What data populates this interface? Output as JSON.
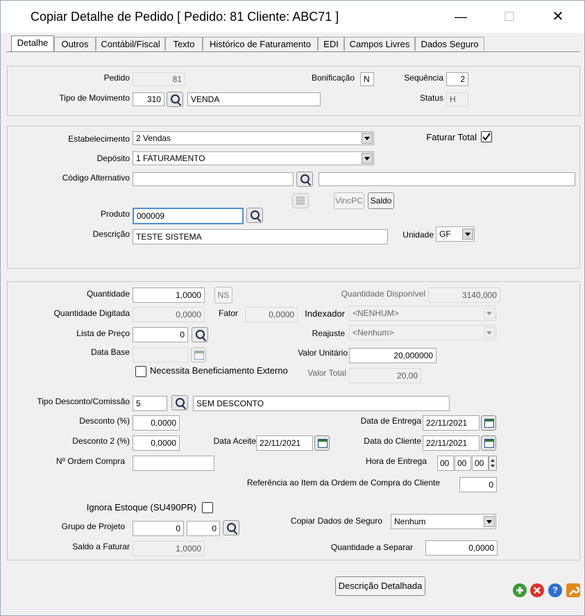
{
  "window": {
    "title": "Copiar Detalhe de Pedido [ Pedido: 81  Cliente: ABC71 ]"
  },
  "tabs": [
    "Detalhe",
    "Outros",
    "Contábil/Fiscal",
    "Texto",
    "Histórico de Faturamento",
    "EDI",
    "Campos Livres",
    "Dados Seguro"
  ],
  "header": {
    "pedido_label": "Pedido",
    "pedido_value": "81",
    "tipo_mov_label": "Tipo de Movimento",
    "tipo_mov_code": "310",
    "tipo_mov_desc": "VENDA",
    "bonificacao_label": "Bonificação",
    "bonificacao_value": "N",
    "sequencia_label": "Sequência",
    "sequencia_value": "2",
    "status_label": "Status",
    "status_value": "H"
  },
  "product": {
    "estab_label": "Estabelecimento",
    "estab_value": "2 Vendas",
    "deposito_label": "Depósito",
    "deposito_value": "1 FATURAMENTO",
    "cod_alt_label": "Código Alternativo",
    "cod_alt_value": "",
    "cod_alt_desc": "",
    "faturar_total_label": "Faturar Total",
    "vincpc_label": "VincPC",
    "saldo_label": "Saldo",
    "produto_label": "Produto",
    "produto_value": "000009",
    "descricao_label": "Descrição",
    "descricao_value": "TESTE SISTEMA",
    "unidade_label": "Unidade",
    "unidade_value": "GF"
  },
  "detail": {
    "quantidade_label": "Quantidade",
    "quantidade_value": "1,0000",
    "ns_label": "NS",
    "qtd_disp_label": "Quantidade Disponível",
    "qtd_disp_value": "3140,000",
    "qtd_dig_label": "Quantidade Digitada",
    "qtd_dig_value": "0,0000",
    "fator_label": "Fator",
    "fator_value": "0,0000",
    "indexador_label": "Indexador",
    "indexador_value": "<NENHUM>",
    "lista_label": "Lista de Preço",
    "lista_value": "0",
    "reajuste_label": "Reajuste",
    "reajuste_value": "<Nenhum>",
    "data_base_label": "Data Base",
    "data_base_value": "",
    "valor_unit_label": "Valor Unitário",
    "valor_unit_value": "20,000000",
    "benef_label": "Necessita Beneficiamento Externo",
    "valor_total_label": "Valor Total",
    "valor_total_value": "20,00",
    "tipo_desc_label": "Tipo Desconto/Comissão",
    "tipo_desc_code": "5",
    "tipo_desc_desc": "SEM DESCONTO",
    "desconto_label": "Desconto (%)",
    "desconto_value": "0,0000",
    "desconto2_label": "Desconto 2 (%)",
    "desconto2_value": "0,0000",
    "data_aceite_label": "Data Aceite",
    "data_aceite_value": "22/11/2021",
    "data_entrega_label": "Data de Entrega",
    "data_entrega_value": "22/11/2021",
    "data_cliente_label": "Data do Cliente",
    "data_cliente_value": "22/11/2021",
    "ordem_label": "Nº Ordem Compra",
    "ordem_value": "",
    "hora_label": "Hora de Entrega",
    "hora_h": "00",
    "hora_m": "00",
    "hora_s": "00",
    "ref_label": "Referência ao Item da Ordem de Compra do Cliente",
    "ref_value": "0",
    "ignora_label": "Ignora Estoque (SU490PR)",
    "grupo_label": "Grupo de Projeto",
    "grupo_v1": "0",
    "grupo_v2": "0",
    "copiar_label": "Copiar Dados de Seguro",
    "copiar_value": "Nenhum",
    "saldo_fat_label": "Saldo a Faturar",
    "saldo_fat_value": "1,0000",
    "qtd_sep_label": "Quantidade a Separar",
    "qtd_sep_value": "0,0000"
  },
  "footer": {
    "desc_det_label": "Descrição Detalhada"
  },
  "colors": {
    "ok": "#3a9a3a",
    "cancel": "#d9342b",
    "help": "#2f6fd1",
    "tool": "#e08a1e"
  }
}
